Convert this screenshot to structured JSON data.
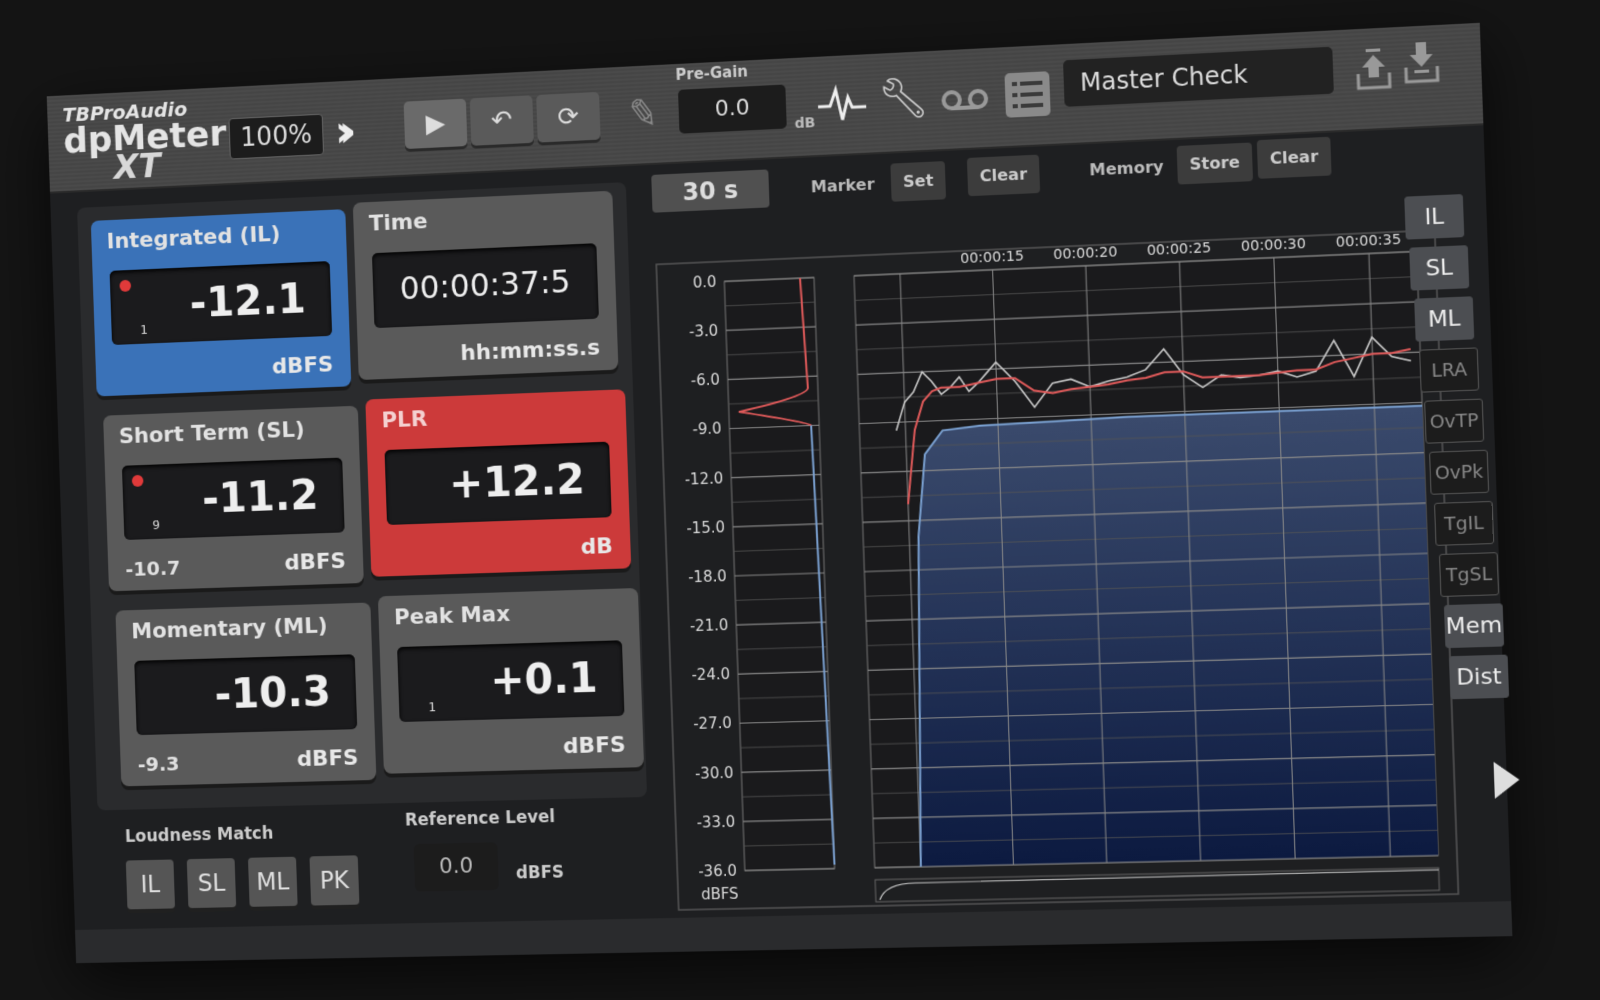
{
  "header": {
    "brand": "TBProAudio",
    "product": "dpMeter",
    "edition": "XT",
    "zoom": "100%",
    "pregain_label": "Pre-Gain",
    "pregain_value": "0.0",
    "pregain_unit": "dB",
    "preset_name": "Master Check",
    "icons": [
      "fast-forward-icon",
      "play-icon",
      "undo-icon",
      "refresh-icon",
      "pencil-icon",
      "waveform-icon",
      "wrench-icon",
      "voicemail-icon",
      "list-icon",
      "upload-icon",
      "download-icon"
    ]
  },
  "meters": {
    "integrated": {
      "title": "Integrated (IL)",
      "value": "-12.1",
      "channel": "1",
      "unit": "dBFS",
      "color": "#3a72b8"
    },
    "time": {
      "title": "Time",
      "value": "00:00:37:5",
      "unit": "hh:mm:ss.s"
    },
    "short_term": {
      "title": "Short Term (SL)",
      "value": "-11.2",
      "channel": "9",
      "max": "-10.7",
      "unit": "dBFS"
    },
    "plr": {
      "title": "PLR",
      "value": "+12.2",
      "unit": "dB",
      "color": "#cc3a3a"
    },
    "momentary": {
      "title": "Momentary (ML)",
      "value": "-10.3",
      "max": "-9.3",
      "unit": "dBFS"
    },
    "peak_max": {
      "title": "Peak Max",
      "value": "+0.1",
      "channel": "1",
      "unit": "dBFS"
    }
  },
  "loudness_match": {
    "label": "Loudness Match",
    "buttons": [
      "IL",
      "SL",
      "ML",
      "PK"
    ]
  },
  "reference": {
    "label": "Reference Level",
    "value": "0.0",
    "unit": "dBFS"
  },
  "graph_controls": {
    "range": "30 s",
    "marker_label": "Marker",
    "marker_set": "Set",
    "marker_clear": "Clear",
    "memory_label": "Memory",
    "memory_store": "Store",
    "memory_clear": "Clear"
  },
  "side_buttons": [
    {
      "label": "IL",
      "active": true
    },
    {
      "label": "SL",
      "active": true
    },
    {
      "label": "ML",
      "active": true
    },
    {
      "label": "LRA",
      "active": false
    },
    {
      "label": "OvTP",
      "active": false
    },
    {
      "label": "OvPk",
      "active": false
    },
    {
      "label": "TgIL",
      "active": false
    },
    {
      "label": "TgSL",
      "active": false
    },
    {
      "label": "Mem",
      "active": true
    },
    {
      "label": "Dist",
      "active": true
    }
  ],
  "chart_data": {
    "type": "line",
    "ylabel": "dBFS",
    "ylim": [
      -36,
      0
    ],
    "yticks": [
      "0.0",
      "-3.0",
      "-6.0",
      "-9.0",
      "-12.0",
      "-15.0",
      "-18.0",
      "-21.0",
      "-24.0",
      "-27.0",
      "-30.0",
      "-33.0",
      "-36.0"
    ],
    "xticks": [
      "00:00:15",
      "00:00:20",
      "00:00:25",
      "00:00:30",
      "00:00:35"
    ],
    "xlim_s": [
      7.5,
      37.5
    ],
    "grid": true,
    "series": [
      {
        "name": "ML",
        "color": "#c8c8c8",
        "x": [
          9.5,
          10,
          10.5,
          11,
          11.5,
          12,
          12.5,
          13,
          13.5,
          14,
          14.5,
          15,
          16,
          17,
          18,
          19,
          20,
          21,
          22,
          23,
          24,
          25,
          26,
          27,
          28,
          29,
          30,
          31,
          32,
          33,
          34,
          35,
          36,
          37
        ],
        "values": [
          -9.5,
          -7.8,
          -7.2,
          -6.0,
          -6.6,
          -7.4,
          -7.0,
          -6.4,
          -7.3,
          -6.8,
          -6.2,
          -5.6,
          -6.8,
          -8.4,
          -7.0,
          -6.8,
          -7.3,
          -7.0,
          -6.8,
          -6.4,
          -5.2,
          -6.8,
          -7.6,
          -6.9,
          -7.1,
          -7.0,
          -6.8,
          -7.2,
          -6.9,
          -5.1,
          -7.3,
          -5.0,
          -6.2,
          -6.5
        ]
      },
      {
        "name": "SL",
        "color": "#e05a5a",
        "x": [
          10,
          10.5,
          11,
          11.5,
          12,
          13,
          14,
          15,
          16,
          17,
          18,
          19,
          20,
          21,
          22,
          23,
          24,
          25,
          26,
          27,
          28,
          29,
          30,
          31,
          32,
          33,
          34,
          35,
          36,
          37
        ],
        "values": [
          -14,
          -9.5,
          -7.8,
          -7.2,
          -7.0,
          -7.0,
          -6.8,
          -6.6,
          -6.6,
          -7.4,
          -7.6,
          -7.4,
          -7.3,
          -7.2,
          -7.0,
          -6.9,
          -6.6,
          -6.6,
          -7.0,
          -7.0,
          -7.0,
          -7.0,
          -6.9,
          -6.8,
          -6.8,
          -6.4,
          -6.2,
          -6.0,
          -6.0,
          -5.8
        ]
      },
      {
        "name": "IL",
        "color": "#7aa0d0",
        "x": [
          10,
          10.5,
          11,
          12,
          14,
          18,
          22,
          26,
          30,
          34,
          37.5
        ],
        "values": [
          -36,
          -16,
          -11,
          -9.6,
          -9.4,
          -9.3,
          -9.2,
          -9.2,
          -9.2,
          -9.2,
          -9.2
        ]
      }
    ],
    "distribution": {
      "peak_dbfs": -8.0,
      "il_dbfs": -9.0
    }
  }
}
